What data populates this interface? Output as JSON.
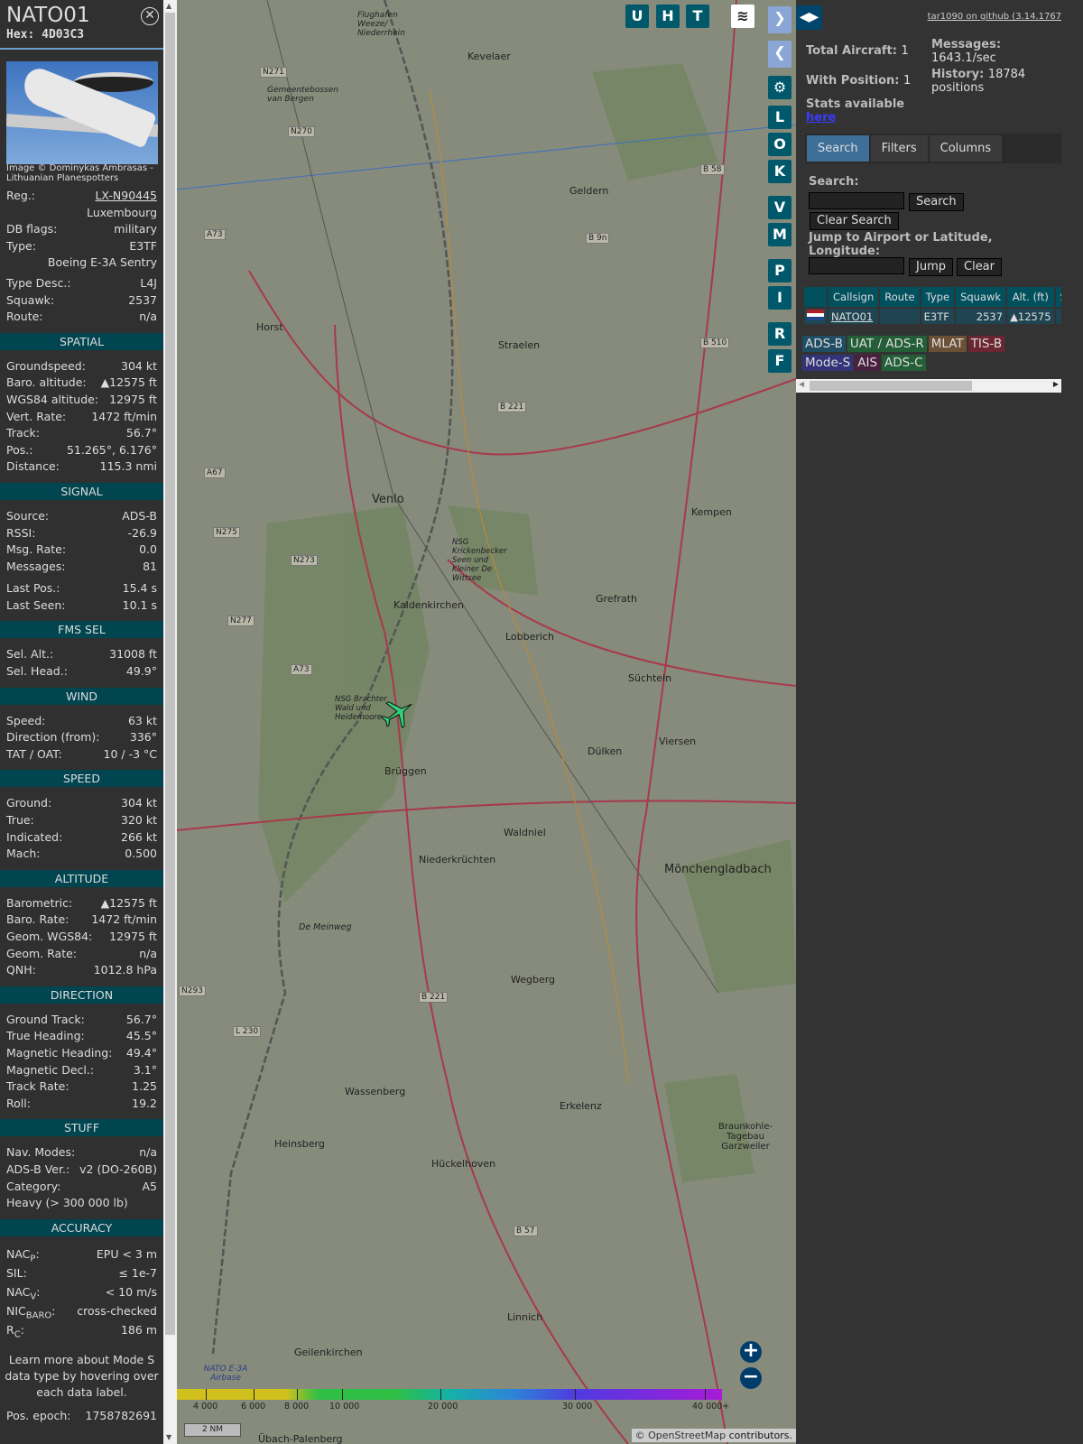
{
  "aircraft": {
    "callsign": "NATO01",
    "hex": "Hex: 4D03C3",
    "photo_credit": "Image © Dominykas Ambrasas - Lithuanian Planespotters",
    "info": [
      {
        "label": "Reg.:",
        "value": "LX-N90445"
      },
      {
        "value": "Luxembourg"
      },
      {
        "label": "DB flags:",
        "value": "military"
      },
      {
        "label": "Type:",
        "value": "E3TF"
      },
      {
        "value": "Boeing E-3A Sentry"
      },
      {
        "label": "Type Desc.:",
        "value": "L4J"
      },
      {
        "label": "Squawk:",
        "value": "2537"
      },
      {
        "label": "Route:",
        "value": "n/a"
      }
    ]
  },
  "sections": {
    "spatial": {
      "title": "SPATIAL",
      "rows": [
        [
          "Groundspeed:",
          "304 kt"
        ],
        [
          "Baro. altitude:",
          "▲12575 ft"
        ],
        [
          "WGS84 altitude:",
          "12975 ft"
        ],
        [
          "Vert. Rate:",
          "1472 ft/min"
        ],
        [
          "Track:",
          "56.7°"
        ],
        [
          "Pos.:",
          "51.265°, 6.176°"
        ],
        [
          "Distance:",
          "115.3 nmi"
        ]
      ]
    },
    "signal": {
      "title": "SIGNAL",
      "rows": [
        [
          "Source:",
          "ADS-B"
        ],
        [
          "RSSI:",
          "-26.9"
        ],
        [
          "Msg. Rate:",
          "0.0"
        ],
        [
          "Messages:",
          "81"
        ]
      ],
      "rows2": [
        [
          "Last Pos.:",
          "15.4 s"
        ],
        [
          "Last Seen:",
          "10.1 s"
        ]
      ]
    },
    "fms": {
      "title": "FMS SEL",
      "rows": [
        [
          "Sel. Alt.:",
          "31008 ft"
        ],
        [
          "Sel. Head.:",
          "49.9°"
        ]
      ]
    },
    "wind": {
      "title": "WIND",
      "rows": [
        [
          "Speed:",
          "63 kt"
        ],
        [
          "Direction (from):",
          "336°"
        ],
        [
          "TAT / OAT:",
          "10 / -3 °C"
        ]
      ]
    },
    "speed": {
      "title": "SPEED",
      "rows": [
        [
          "Ground:",
          "304 kt"
        ],
        [
          "True:",
          "320 kt"
        ],
        [
          "Indicated:",
          "266 kt"
        ],
        [
          "Mach:",
          "0.500"
        ]
      ]
    },
    "altitude": {
      "title": "ALTITUDE",
      "rows": [
        [
          "Barometric:",
          "▲12575 ft"
        ],
        [
          "Baro. Rate:",
          "1472 ft/min"
        ],
        [
          "Geom. WGS84:",
          "12975 ft"
        ],
        [
          "Geom. Rate:",
          "n/a"
        ],
        [
          "QNH:",
          "1012.8 hPa"
        ]
      ]
    },
    "direction": {
      "title": "DIRECTION",
      "rows": [
        [
          "Ground Track:",
          "56.7°"
        ],
        [
          "True Heading:",
          "45.5°"
        ],
        [
          "Magnetic Heading:",
          "49.4°"
        ],
        [
          "Magnetic Decl.:",
          "3.1°"
        ],
        [
          "Track Rate:",
          "1.25"
        ],
        [
          "Roll:",
          "19.2"
        ]
      ]
    },
    "stuff": {
      "title": "STUFF",
      "rows": [
        [
          "Nav. Modes:",
          "n/a"
        ],
        [
          "ADS-B Ver.:",
          "v2 (DO-260B)"
        ],
        [
          "Category:",
          "A5"
        ]
      ],
      "note": "Heavy (> 300 000 lb)"
    },
    "accuracy": {
      "title": "ACCURACY",
      "rows": [
        [
          "NAC",
          "P",
          ":",
          "EPU < 3 m"
        ],
        [
          "SIL",
          "",
          ":",
          "≤ 1e-7"
        ],
        [
          "NAC",
          "V",
          ":",
          "< 10 m/s"
        ],
        [
          "NIC",
          "BARO",
          ":",
          "cross-checked"
        ],
        [
          "R",
          "C",
          ":",
          "186 m"
        ]
      ]
    }
  },
  "learn_more": "Learn more about Mode S data type by hovering over each data label.",
  "pos_epoch": {
    "label": "Pos. epoch:",
    "value": "1758782691"
  },
  "map": {
    "buttons_top": [
      "U",
      "H",
      "T"
    ],
    "side_buttons": [
      "L",
      "O",
      "K",
      "V",
      "M",
      "P",
      "I",
      "R",
      "F"
    ],
    "towns": [
      "Kevelaer",
      "Flughafen Weeze/ Niederrhein",
      "Gemeentebossen van Bergen",
      "Geldern",
      "Horst",
      "Straelen",
      "Venlo",
      "Kempen",
      "NSG Krickenbecker Seen und Kleiner De Wittsee",
      "Kaldenkirchen",
      "Grefrath",
      "Lobberich",
      "Süchteln",
      "NSG Brachter Wald und Heidemoore",
      "Viersen",
      "Brüggen",
      "Dülken",
      "Waldniel",
      "Niederkrüchten",
      "Mönchengladbach",
      "De Meinweg",
      "Wegberg",
      "Wassenberg",
      "Erkelenz",
      "Heinsberg",
      "Hückelhoven",
      "Braunkohle-Tagebau Garzweiler",
      "Linnich",
      "Geilenkirchen",
      "NATO E-3A Airbase",
      "Übach-Palenberg"
    ],
    "roads": [
      "N271",
      "N270",
      "B 58",
      "A73",
      "B 9n",
      "B 510",
      "B 221",
      "A67",
      "N275",
      "N273",
      "N277",
      "A73",
      "N293",
      "B 221",
      "L 230",
      "B 57"
    ],
    "color_scale": [
      "4 000",
      "6 000",
      "8 000",
      "10 000",
      "20 000",
      "30 000",
      "40 000+"
    ],
    "scale_label": "2 NM",
    "attribution_prefix": "© ",
    "attribution_link": "OpenStreetMap",
    "attribution_suffix": " contributors."
  },
  "right": {
    "github": "tar1090 on github (3.14.1767)",
    "total_label": "Total Aircraft:",
    "total": "1",
    "withpos_label": "With Position:",
    "withpos": "1",
    "messages_label": "Messages:",
    "messages": "1643.1/sec",
    "history_label": "History:",
    "history": "18784 positions",
    "stats_label": "Stats available",
    "stats_link": "here",
    "tabs": [
      "Search",
      "Filters",
      "Columns"
    ],
    "search_label": "Search:",
    "search_btn": "Search",
    "clear_search_btn": "Clear Search",
    "jump_label": "Jump to Airport or Latitude, Longitude:",
    "jump_btn": "Jump",
    "clear_btn": "Clear",
    "columns": [
      "Callsign",
      "Route",
      "Type",
      "Squawk",
      "Alt. (ft)",
      "Spd"
    ],
    "rows": [
      {
        "callsign": "NATO01",
        "route": "",
        "type": "E3TF",
        "squawk": "2537",
        "alt": "▲12575",
        "spd": ""
      }
    ],
    "sources": [
      {
        "name": "ADS-B",
        "color": "#1f4d63"
      },
      {
        "name": "UAT / ADS-R",
        "color": "#235e37"
      },
      {
        "name": "MLAT",
        "color": "#6b5035"
      },
      {
        "name": "TIS-B",
        "color": "#6b2632"
      },
      {
        "name": "Mode-S",
        "color": "#33337a"
      },
      {
        "name": "AIS",
        "color": "#4a2040"
      },
      {
        "name": "ADS-C",
        "color": "#235e37"
      }
    ]
  }
}
